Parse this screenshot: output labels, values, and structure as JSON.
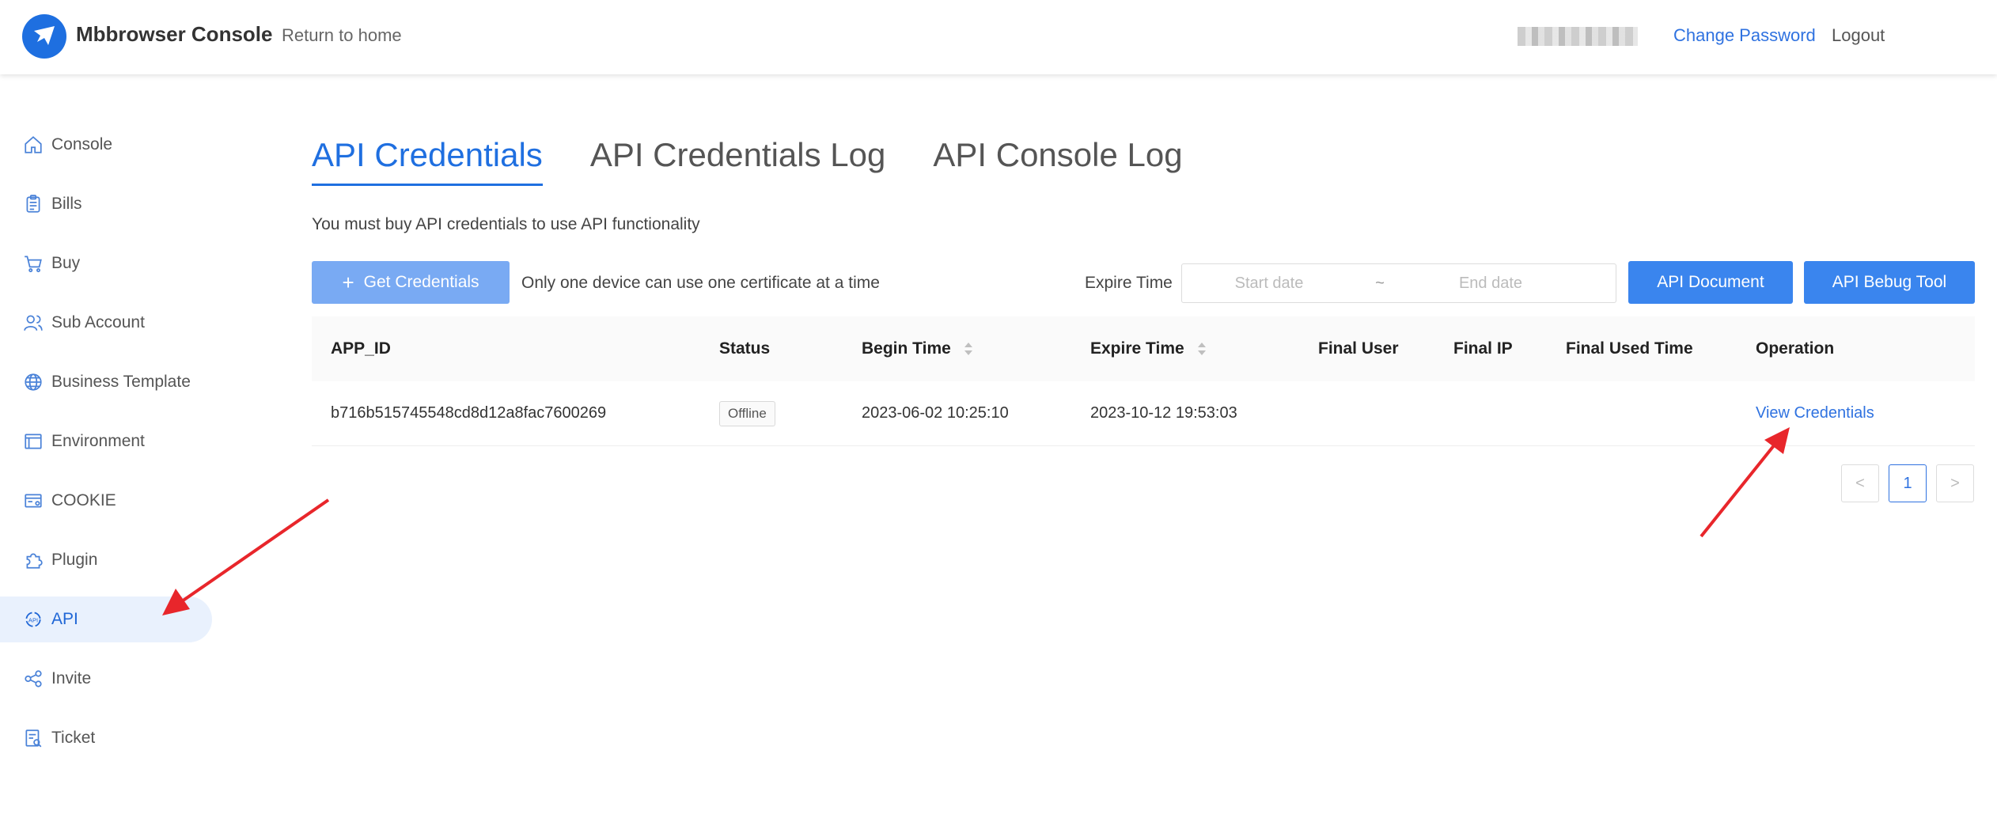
{
  "header": {
    "brand": "Mbbrowser Console",
    "return_home": "Return to home",
    "change_password": "Change Password",
    "logout": "Logout"
  },
  "sidebar": {
    "items": [
      {
        "label": "Console",
        "icon": "home-icon"
      },
      {
        "label": "Bills",
        "icon": "clipboard-icon"
      },
      {
        "label": "Buy",
        "icon": "cart-icon"
      },
      {
        "label": "Sub Account",
        "icon": "users-icon"
      },
      {
        "label": "Business Template",
        "icon": "globe-icon"
      },
      {
        "label": "Environment",
        "icon": "window-icon"
      },
      {
        "label": "COOKIE",
        "icon": "cookie-card-icon"
      },
      {
        "label": "Plugin",
        "icon": "puzzle-icon"
      },
      {
        "label": "API",
        "icon": "api-icon",
        "active": true
      },
      {
        "label": "Invite",
        "icon": "share-icon"
      },
      {
        "label": "Ticket",
        "icon": "ticket-icon"
      }
    ]
  },
  "tabs": [
    {
      "label": "API Credentials",
      "active": true
    },
    {
      "label": "API Credentials Log"
    },
    {
      "label": "API Console Log"
    }
  ],
  "notice": "You must buy API credentials to use API functionality",
  "toolbar": {
    "get_credentials": "Get Credentials",
    "device_note": "Only one device can use one certificate at a time",
    "expire_label": "Expire Time",
    "start_placeholder": "Start date",
    "date_separator": "~",
    "end_placeholder": "End date",
    "api_document": "API Document",
    "api_debug_tool": "API Bebug Tool"
  },
  "table": {
    "headers": [
      "APP_ID",
      "Status",
      "Begin Time",
      "Expire Time",
      "Final User",
      "Final IP",
      "Final Used Time",
      "Operation"
    ],
    "rows": [
      {
        "app_id": "b716b515745548cd8d12a8fac7600269",
        "status": "Offline",
        "begin_time": "2023-06-02 10:25:10",
        "expire_time": "2023-10-12 19:53:03",
        "final_user": "",
        "final_ip": "",
        "final_used_time": "",
        "operation": "View Credentials"
      }
    ]
  },
  "pagination": {
    "prev": "<",
    "current": "1",
    "next": ">"
  },
  "colors": {
    "accent": "#1f6fe0",
    "annotation_arrow": "#e8262b"
  }
}
